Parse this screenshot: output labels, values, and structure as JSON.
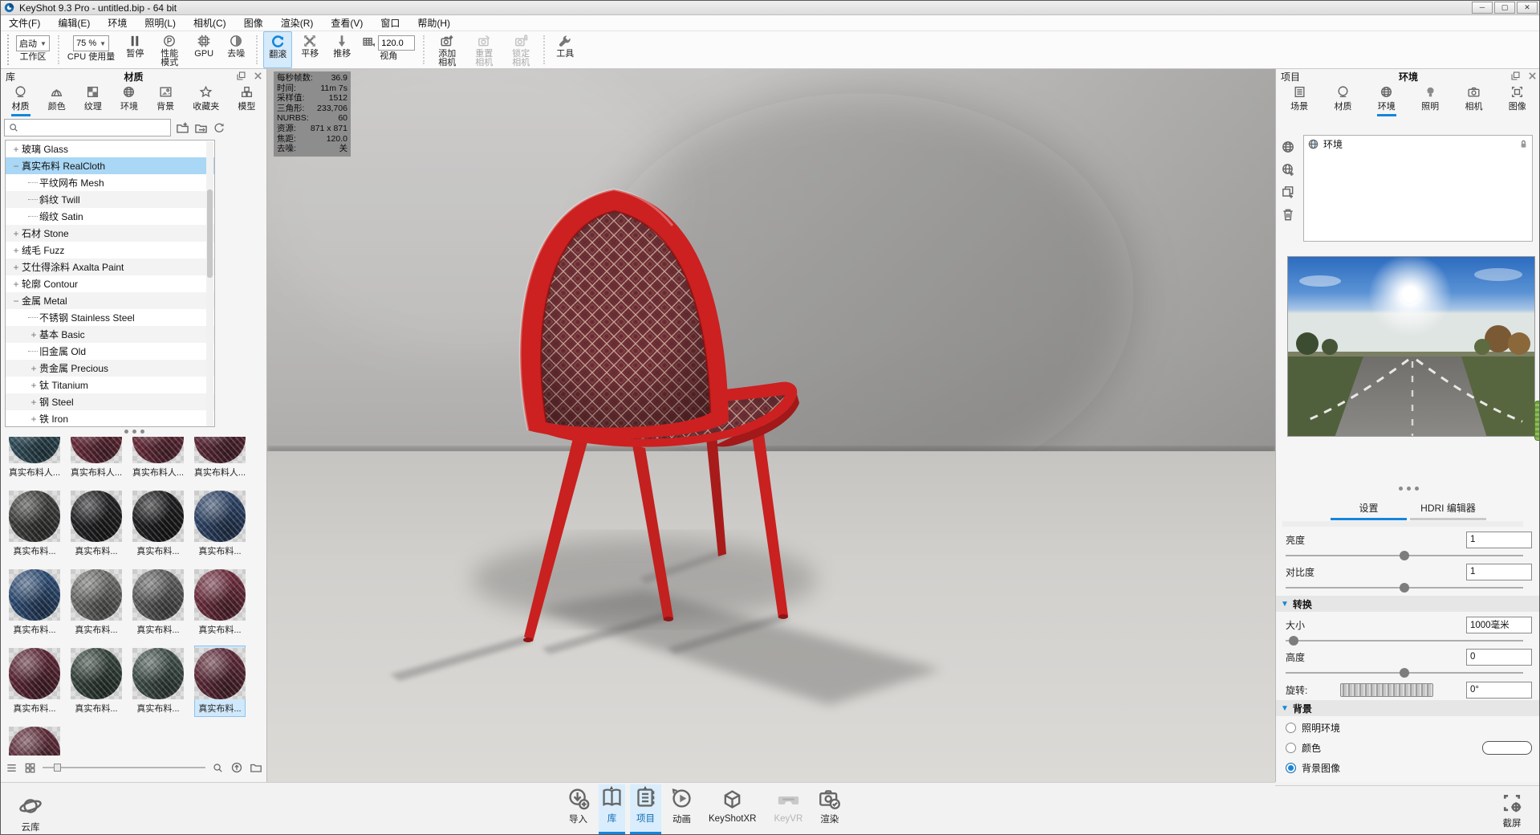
{
  "window": {
    "title": "KeyShot 9.3 Pro  - untitled.bip  - 64 bit",
    "min": "─",
    "max": "▢",
    "close": "✕"
  },
  "menu": [
    "文件(F)",
    "编辑(E)",
    "环境",
    "照明(L)",
    "相机(C)",
    "图像",
    "渲染(R)",
    "查看(V)",
    "窗口",
    "帮助(H)"
  ],
  "toolbar": {
    "start": "启动",
    "workspace": "工作区",
    "cpu_value": "75 %",
    "cpu": "CPU 使用量",
    "pause": "暂停",
    "performance": "性能\n模式",
    "gpu": "GPU",
    "denoise": "去噪",
    "tumble": "翻滚",
    "pan": "平移",
    "dolly": "推移",
    "fov": "120.0",
    "fov_label": "视角",
    "add_camera": "添加\n相机",
    "reset_camera": "重置\n相机",
    "lock_camera": "锁定\n相机",
    "tools": "工具"
  },
  "library": {
    "panel": "库",
    "title": "材质",
    "tabs": [
      {
        "label": "材质",
        "icon": "sphere",
        "active": true
      },
      {
        "label": "颜色",
        "icon": "shell"
      },
      {
        "label": "纹理",
        "icon": "checker"
      },
      {
        "label": "环境",
        "icon": "globe"
      },
      {
        "label": "背景",
        "icon": "photo"
      },
      {
        "label": "收藏夹",
        "icon": "star"
      },
      {
        "label": "模型",
        "icon": "cubes"
      }
    ],
    "tree": [
      {
        "exp": "+",
        "label": "玻璃 Glass",
        "lvl": 0
      },
      {
        "exp": "−",
        "label": "真实布料 RealCloth",
        "lvl": 0,
        "selected": true
      },
      {
        "exp": "",
        "label": "平纹网布 Mesh",
        "lvl": 1
      },
      {
        "exp": "",
        "label": "斜纹 Twill",
        "lvl": 1
      },
      {
        "exp": "",
        "label": "缎纹 Satin",
        "lvl": 1
      },
      {
        "exp": "+",
        "label": "石材 Stone",
        "lvl": 0
      },
      {
        "exp": "+",
        "label": "绒毛 Fuzz",
        "lvl": 0
      },
      {
        "exp": "+",
        "label": "艾仕得涂料 Axalta Paint",
        "lvl": 0
      },
      {
        "exp": "+",
        "label": "轮廓 Contour",
        "lvl": 0
      },
      {
        "exp": "−",
        "label": "金属 Metal",
        "lvl": 0
      },
      {
        "exp": "",
        "label": "不锈钢 Stainless Steel",
        "lvl": 1
      },
      {
        "exp": "+",
        "label": "基本 Basic",
        "lvl": 1
      },
      {
        "exp": "",
        "label": "旧金属 Old",
        "lvl": 1
      },
      {
        "exp": "+",
        "label": "贵金属 Precious",
        "lvl": 1
      },
      {
        "exp": "+",
        "label": "钛 Titanium",
        "lvl": 1
      },
      {
        "exp": "+",
        "label": "钢 Steel",
        "lvl": 1
      },
      {
        "exp": "+",
        "label": "铁 Iron",
        "lvl": 1
      }
    ],
    "thumbnails": [
      {
        "label": "真实布料人...",
        "color": "#33505c",
        "partial": true
      },
      {
        "label": "真实布料人...",
        "color": "#6b2f3e",
        "partial": true
      },
      {
        "label": "真实布料人...",
        "color": "#6b2f3e",
        "partial": true
      },
      {
        "label": "真实布料人...",
        "color": "#5f2c3a",
        "partial": true
      },
      {
        "label": "真实布料...",
        "color": "#3f3f3d"
      },
      {
        "label": "真实布料...",
        "color": "#232325"
      },
      {
        "label": "真实布料...",
        "color": "#1f1f21"
      },
      {
        "label": "真实布料...",
        "color": "#2e4466"
      },
      {
        "label": "真实布料...",
        "color": "#2f4d74"
      },
      {
        "label": "真实布料...",
        "color": "#6d6d6b"
      },
      {
        "label": "真实布料...",
        "color": "#5e5e5e"
      },
      {
        "label": "真实布料...",
        "color": "#6d2e3e"
      },
      {
        "label": "真实布料...",
        "color": "#5c2836"
      },
      {
        "label": "真实布料...",
        "color": "#36443c"
      },
      {
        "label": "真实布料...",
        "color": "#41504b"
      },
      {
        "label": "真实布料...",
        "color": "#5e2b39",
        "selected": true
      },
      {
        "label": "真实布料...",
        "color": "#5f2e3a"
      }
    ]
  },
  "stats": [
    {
      "label": "每秒帧数:",
      "value": "36.9"
    },
    {
      "label": "时间:",
      "value": "11m 7s"
    },
    {
      "label": "采样值:",
      "value": "1512"
    },
    {
      "label": "三角形:",
      "value": "233,706"
    },
    {
      "label": "NURBS:",
      "value": "60"
    },
    {
      "label": "资源:",
      "value": "871 x 871"
    },
    {
      "label": "焦距:",
      "value": "120.0"
    },
    {
      "label": "去噪:",
      "value": "关"
    }
  ],
  "project": {
    "panel": "项目",
    "title": "环境",
    "tabs": [
      {
        "label": "场景",
        "icon": "scene"
      },
      {
        "label": "材质",
        "icon": "sphere"
      },
      {
        "label": "环境",
        "icon": "globe",
        "active": true
      },
      {
        "label": "照明",
        "icon": "bulb"
      },
      {
        "label": "相机",
        "icon": "camera"
      },
      {
        "label": "图像",
        "icon": "frame"
      }
    ],
    "env_item": "环境",
    "settings_tab": "设置",
    "hdri_tab": "HDRI 编辑器",
    "rows": {
      "brightness": "亮度",
      "brightness_value": "1",
      "contrast": "对比度",
      "contrast_value": "1",
      "transform": "转换",
      "size": "大小",
      "size_value": "1000毫米",
      "height": "高度",
      "height_value": "0",
      "rotation": "旋转:",
      "rotation_value": "0°",
      "background": "背景"
    },
    "bg_options": [
      {
        "label": "照明环境",
        "checked": false
      },
      {
        "label": "颜色",
        "checked": false,
        "swatch": true
      },
      {
        "label": "背景图像",
        "checked": true
      }
    ]
  },
  "bottombar": {
    "cloud": "云库",
    "items": [
      {
        "label": "导入",
        "icon": "import"
      },
      {
        "label": "库",
        "icon": "book",
        "active": true
      },
      {
        "label": "项目",
        "icon": "pages",
        "active": true
      },
      {
        "label": "动画",
        "icon": "anim"
      },
      {
        "label": "KeyShotXR",
        "icon": "xr"
      },
      {
        "label": "KeyVR",
        "icon": "vr",
        "disabled": true
      },
      {
        "label": "渲染",
        "icon": "render"
      }
    ],
    "screenshot": "截屏"
  },
  "colors": {
    "accent": "#1486db",
    "chair_red": "#cd2020",
    "fabric_base": "#6d3036",
    "tree_selection": "#a9d7f5"
  }
}
